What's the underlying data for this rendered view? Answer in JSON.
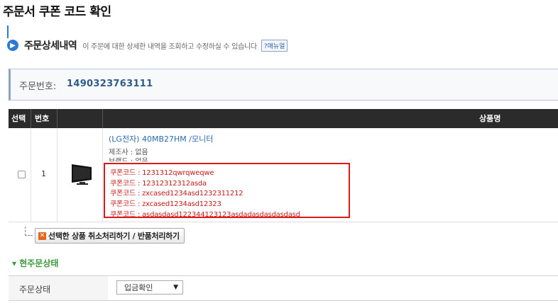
{
  "page_title": "주문서 쿠폰 코드 확인",
  "section": {
    "title": "주문상세내역",
    "description": "이 주문에 대한 상세한 내역을 조회하고 수정하실 수 있습니다",
    "manual_button": "?매뉴얼"
  },
  "order": {
    "label": "주문번호:",
    "number": "1490323763111"
  },
  "table": {
    "headers": {
      "select": "선택",
      "no": "번호",
      "product": "상품명"
    },
    "rows": [
      {
        "number": "1",
        "product_name": "(LG전자) 40MB27HM /모니터",
        "maker": "제조사 : 없음",
        "brand": "브랜드 : 없음",
        "coupons": [
          "쿠폰코드 : 1231312qwrqweqwe",
          "쿠폰코드 : 12312312312asda",
          "쿠폰코드 : zxcased1234asd1232311212",
          "쿠폰코드 : zxcased1234asd12323",
          "쿠폰코드 : asdasdasd122344123123asdadasdasdasdasd"
        ]
      }
    ]
  },
  "actions": {
    "cancel_return_button": "선택한 상품 취소처리하기 / 반품처리하기"
  },
  "status": {
    "section_title": "▾ 현주문상태",
    "label": "주문상태",
    "selected": "입금확인"
  },
  "colors": {
    "accent_blue": "#2b7bd6",
    "coupon_red": "#c61a1a",
    "highlight_border": "#dd1a1a",
    "status_green": "#3c9a3c",
    "header_dark": "#2b2b2b"
  }
}
